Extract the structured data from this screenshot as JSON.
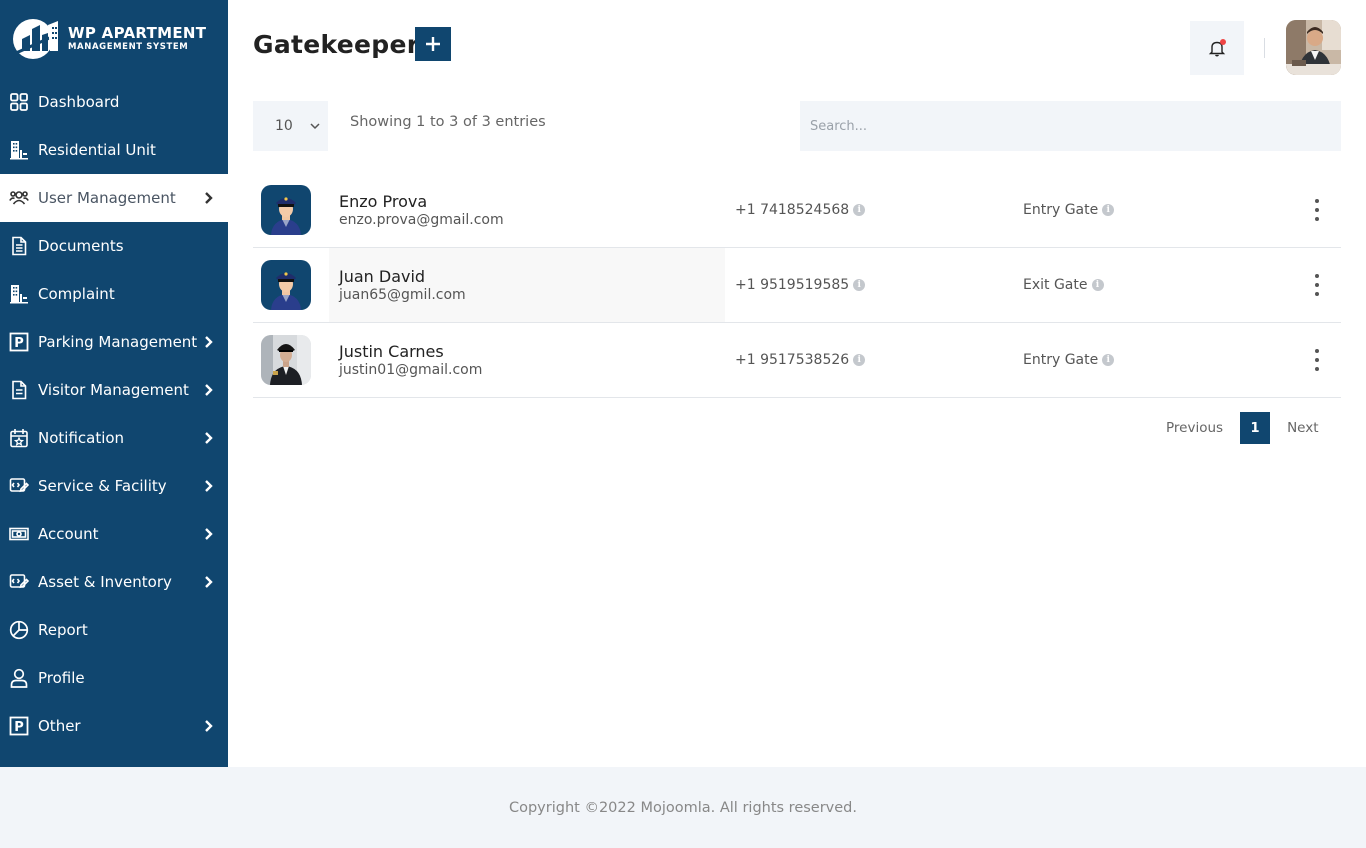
{
  "brand": {
    "title": "WP APARTMENT",
    "subtitle": "MANAGEMENT SYSTEM",
    "color": "#10466f"
  },
  "sidebar": {
    "items": [
      {
        "label": "Dashboard",
        "icon": "dashboard-grid-icon",
        "has_submenu": false,
        "active": false
      },
      {
        "label": "Residential Unit",
        "icon": "building-icon",
        "has_submenu": false,
        "active": false
      },
      {
        "label": "User Management",
        "icon": "users-icon",
        "has_submenu": true,
        "active": true
      },
      {
        "label": "Documents",
        "icon": "document-icon",
        "has_submenu": false,
        "active": false
      },
      {
        "label": "Complaint",
        "icon": "building-icon",
        "has_submenu": false,
        "active": false
      },
      {
        "label": "Parking Management",
        "icon": "parking-icon",
        "has_submenu": true,
        "active": false
      },
      {
        "label": "Visitor Management",
        "icon": "document-icon",
        "has_submenu": true,
        "active": false
      },
      {
        "label": "Notification",
        "icon": "calendar-star-icon",
        "has_submenu": true,
        "active": false
      },
      {
        "label": "Service & Facility",
        "icon": "service-icon",
        "has_submenu": true,
        "active": false
      },
      {
        "label": "Account",
        "icon": "money-icon",
        "has_submenu": true,
        "active": false
      },
      {
        "label": "Asset & Inventory",
        "icon": "service-icon",
        "has_submenu": true,
        "active": false
      },
      {
        "label": "Report",
        "icon": "pie-chart-icon",
        "has_submenu": false,
        "active": false
      },
      {
        "label": "Profile",
        "icon": "user-icon",
        "has_submenu": false,
        "active": false
      },
      {
        "label": "Other",
        "icon": "parking-icon",
        "has_submenu": true,
        "active": false
      }
    ]
  },
  "header": {
    "title": "Gatekeeper",
    "add_icon": "plus-icon",
    "notification_icon": "bell-icon"
  },
  "table_controls": {
    "page_length": "10",
    "info": "Showing 1 to 3 of 3 entries",
    "search_placeholder": "Search..."
  },
  "gatekeepers": [
    {
      "name": "Enzo Prova",
      "email": "enzo.prova@gmail.com",
      "phone": "+1 7418524568",
      "gate": "Entry Gate",
      "avatar": "guard-illustration"
    },
    {
      "name": "Juan David",
      "email": "juan65@gmil.com",
      "phone": "+1 9519519585",
      "gate": "Exit Gate",
      "avatar": "guard-illustration"
    },
    {
      "name": "Justin Carnes",
      "email": "justin01@gmail.com",
      "phone": "+1 9517538526",
      "gate": "Entry Gate",
      "avatar": "guard-photo"
    }
  ],
  "pagination": {
    "previous": "Previous",
    "current": "1",
    "next": "Next"
  },
  "footer": {
    "copyright": "Copyright ©2022 Mojoomla. All rights reserved."
  }
}
